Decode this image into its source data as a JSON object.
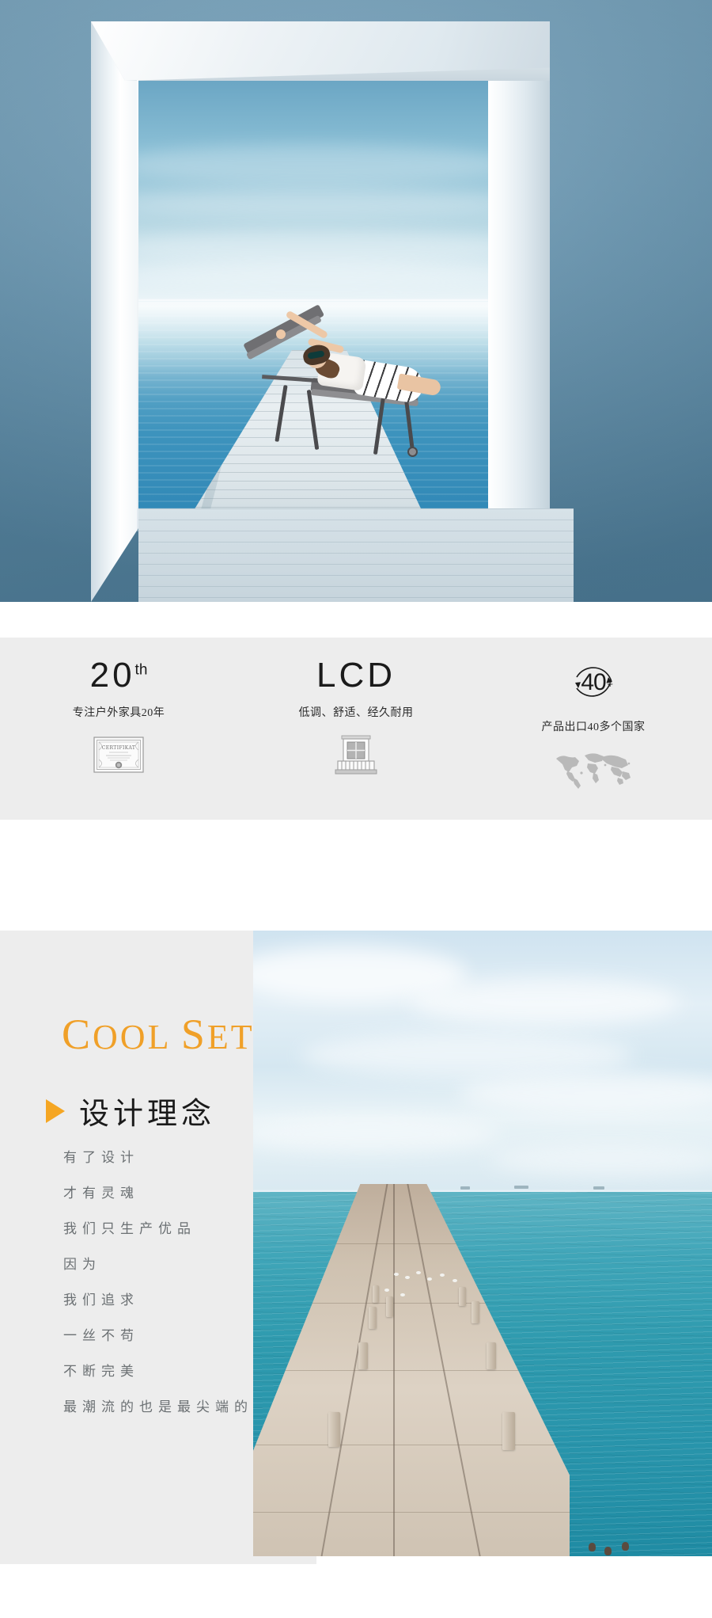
{
  "page": {
    "title": "户外家具产品详情页",
    "background_color": "#ffffff",
    "accent_color": "#f5a623",
    "panel_color": "#ededed"
  },
  "hero": {
    "name": "hero-banner",
    "alt": "女士戴墨镜躺在户外躺椅上，位于海边木栈道，白色立体门框景深效果",
    "frame_color": "#ffffff",
    "wall_color": "#5f90ad"
  },
  "features": {
    "background_color": "#ededed",
    "items": [
      {
        "headline": "20",
        "superscript": "th",
        "caption": "专注户外家具20年",
        "icon": "certificate-icon",
        "icon_alt": "证书"
      },
      {
        "headline": "LCD",
        "superscript": "",
        "caption": "低调、舒适、经久耐用",
        "icon": "balcony-building-icon",
        "icon_alt": "阳台建筑"
      },
      {
        "headline": "40",
        "superscript": "+",
        "caption": "产品出口40多个国家",
        "icon": "world-map-icon",
        "icon_alt": "世界地图"
      }
    ]
  },
  "design": {
    "eyebrow": "Cool set",
    "eyebrow_color": "#f0a028",
    "heading": "设计理念",
    "bullet_icon": "triangle-right-icon",
    "lines": [
      "有了设计",
      "才有灵魂",
      "我们只生产优品",
      "因为",
      "我们追求",
      "一丝不苟",
      "不断完美",
      "最潮流的也是最尖端的"
    ],
    "photo": {
      "name": "pier-photo",
      "alt": "混凝土海堤栈桥伸入碧绿海水，天空多云，栈桥上有海鸥"
    }
  },
  "certificate": {
    "title": "CERTIFIKAT"
  }
}
